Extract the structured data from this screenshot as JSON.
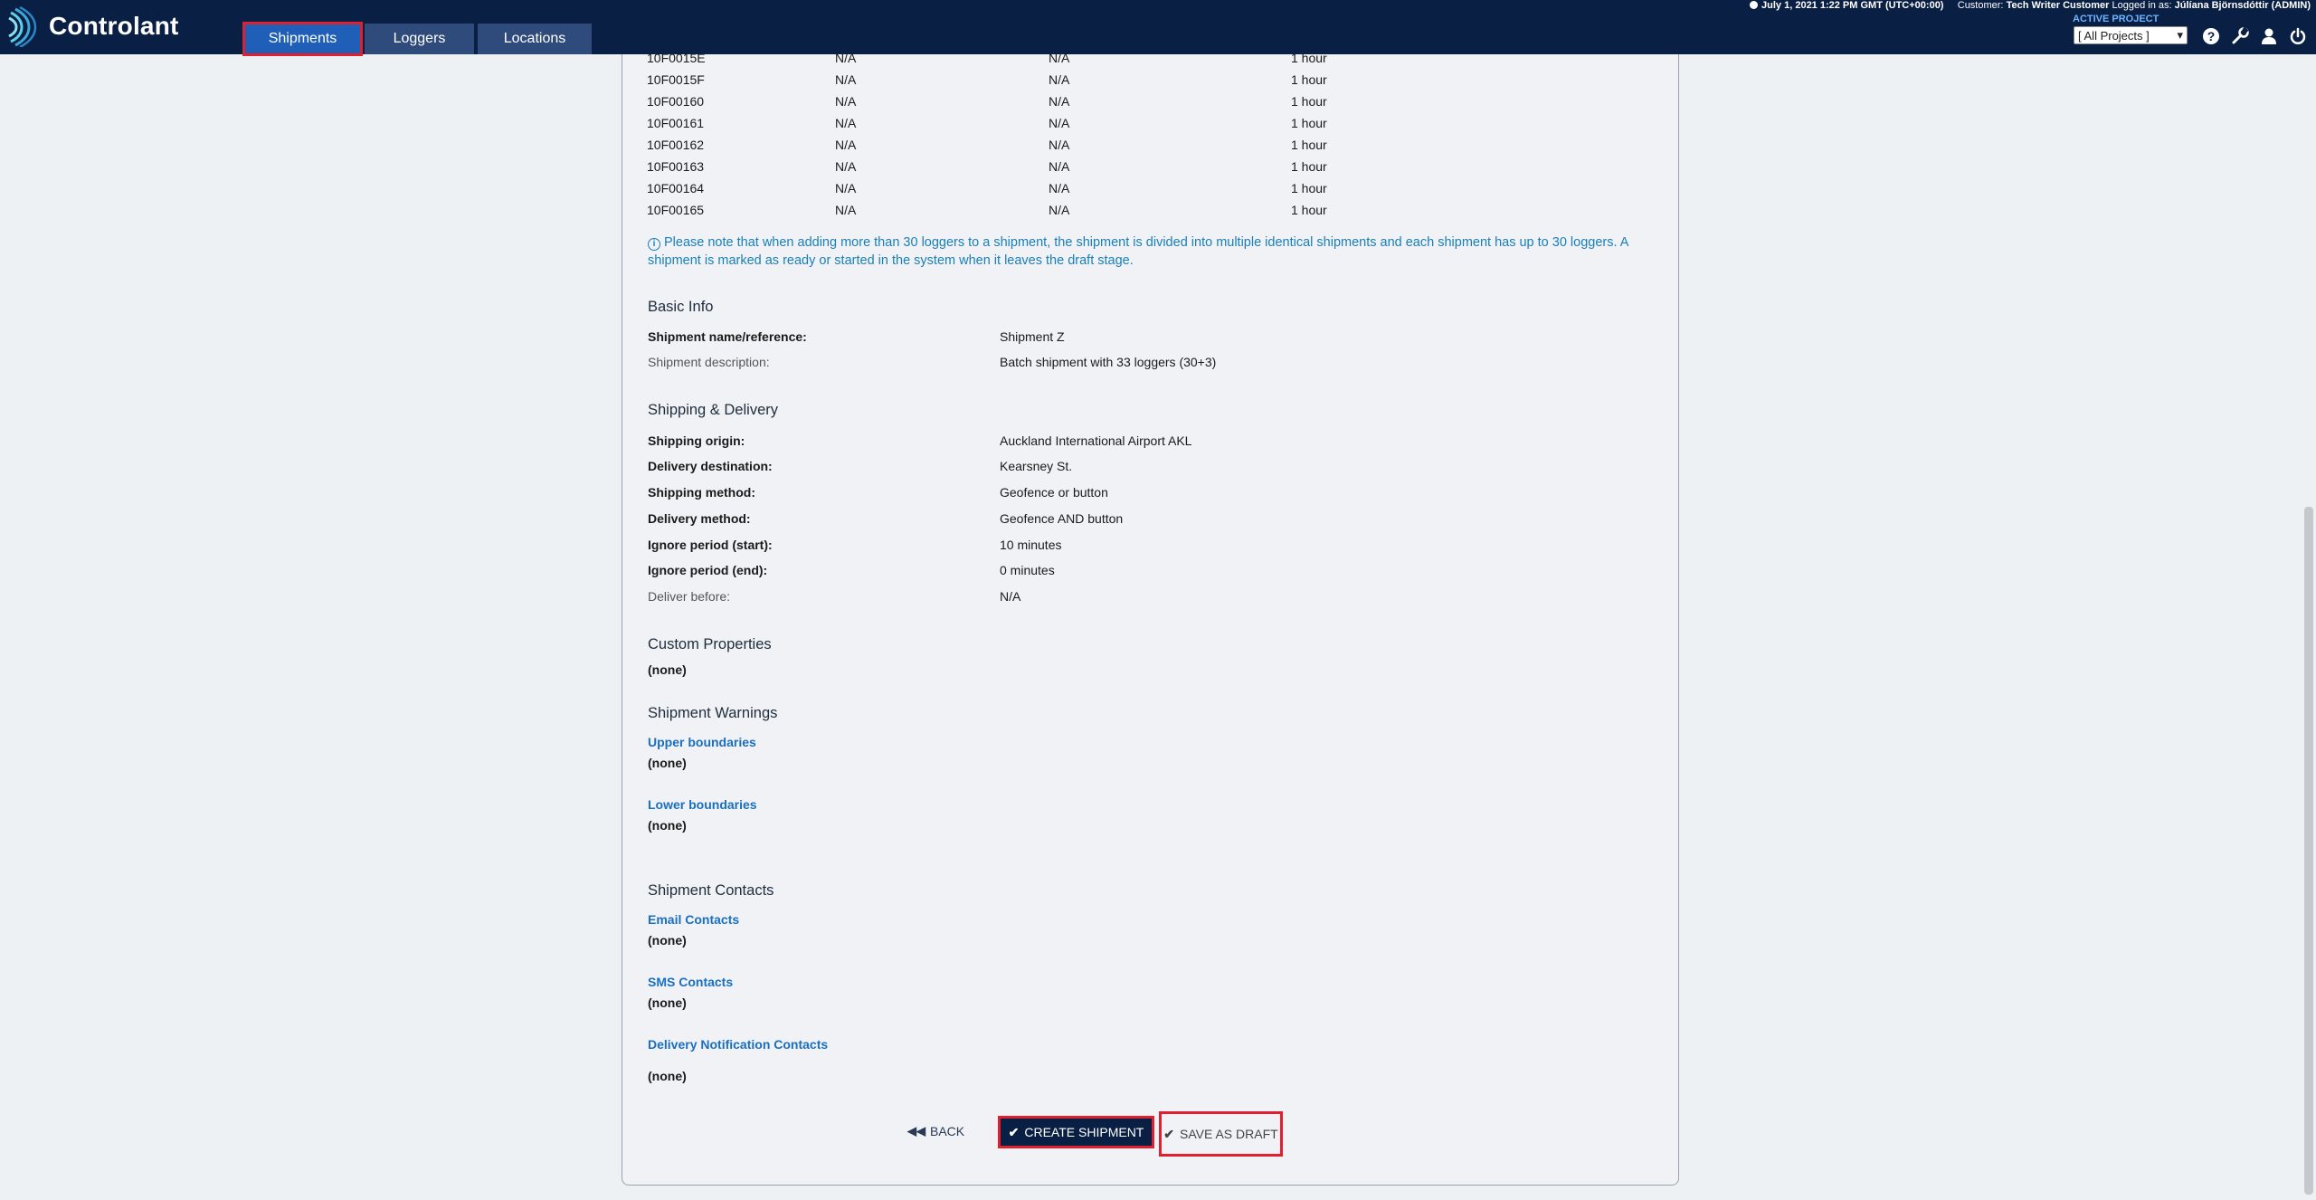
{
  "app": {
    "brand": "Controlant",
    "nav_tabs": [
      {
        "label": "Shipments",
        "active": true
      },
      {
        "label": "Loggers",
        "active": false
      },
      {
        "label": "Locations",
        "active": false
      }
    ],
    "status": {
      "datetime": "July 1, 2021 1:22 PM GMT (UTC+00:00)",
      "customer_label": "Customer:",
      "customer_value": "Tech Writer Customer",
      "logged_in_label": "Logged in as:",
      "logged_in_value": "Júlíana Björnsdóttir (ADMIN)"
    },
    "active_project_label": "ACTIVE PROJECT",
    "project_select": "[ All Projects ]",
    "icons": [
      "help-icon",
      "wrench-icon",
      "user-icon",
      "power-icon"
    ],
    "colors": {
      "topbar": "#0a1f44",
      "accent_link": "#1a6fc0",
      "highlight": "#e0202e",
      "note": "#1a7fb8"
    }
  },
  "loggers": [
    {
      "id": "10F0015E",
      "a": "N/A",
      "b": "N/A",
      "interval": "1 hour"
    },
    {
      "id": "10F0015F",
      "a": "N/A",
      "b": "N/A",
      "interval": "1 hour"
    },
    {
      "id": "10F00160",
      "a": "N/A",
      "b": "N/A",
      "interval": "1 hour"
    },
    {
      "id": "10F00161",
      "a": "N/A",
      "b": "N/A",
      "interval": "1 hour"
    },
    {
      "id": "10F00162",
      "a": "N/A",
      "b": "N/A",
      "interval": "1 hour"
    },
    {
      "id": "10F00163",
      "a": "N/A",
      "b": "N/A",
      "interval": "1 hour"
    },
    {
      "id": "10F00164",
      "a": "N/A",
      "b": "N/A",
      "interval": "1 hour"
    },
    {
      "id": "10F00165",
      "a": "N/A",
      "b": "N/A",
      "interval": "1 hour"
    }
  ],
  "note": "Please note that when adding more than 30 loggers to a shipment, the shipment is divided into multiple identical shipments and each shipment has up to 30 loggers. A shipment is marked as ready or started in the system when it leaves the draft stage.",
  "basic_info": {
    "title": "Basic Info",
    "name_label": "Shipment name/reference:",
    "name_value": "Shipment Z",
    "desc_label": "Shipment description:",
    "desc_value": "Batch shipment with 33 loggers (30+3)"
  },
  "shipping": {
    "title": "Shipping & Delivery",
    "origin_label": "Shipping origin:",
    "origin_value": "Auckland International Airport AKL",
    "destination_label": "Delivery destination:",
    "destination_value": "Kearsney St.",
    "ship_method_label": "Shipping method:",
    "ship_method_value": "Geofence or button",
    "deliv_method_label": "Delivery method:",
    "deliv_method_value": "Geofence AND button",
    "ignore_start_label": "Ignore period (start):",
    "ignore_start_value": "10 minutes",
    "ignore_end_label": "Ignore period (end):",
    "ignore_end_value": "0 minutes",
    "deliver_before_label": "Deliver before:",
    "deliver_before_value": "N/A"
  },
  "custom_properties": {
    "title": "Custom Properties",
    "value": "(none)"
  },
  "warnings": {
    "title": "Shipment Warnings",
    "upper_label": "Upper boundaries",
    "upper_value": "(none)",
    "lower_label": "Lower boundaries",
    "lower_value": "(none)"
  },
  "contacts": {
    "title": "Shipment Contacts",
    "email_label": "Email Contacts",
    "email_value": "(none)",
    "sms_label": "SMS Contacts",
    "sms_value": "(none)",
    "delivery_label": "Delivery Notification Contacts",
    "delivery_value": "(none)"
  },
  "actions": {
    "back": "BACK",
    "create": "CREATE SHIPMENT",
    "draft": "SAVE AS DRAFT"
  }
}
